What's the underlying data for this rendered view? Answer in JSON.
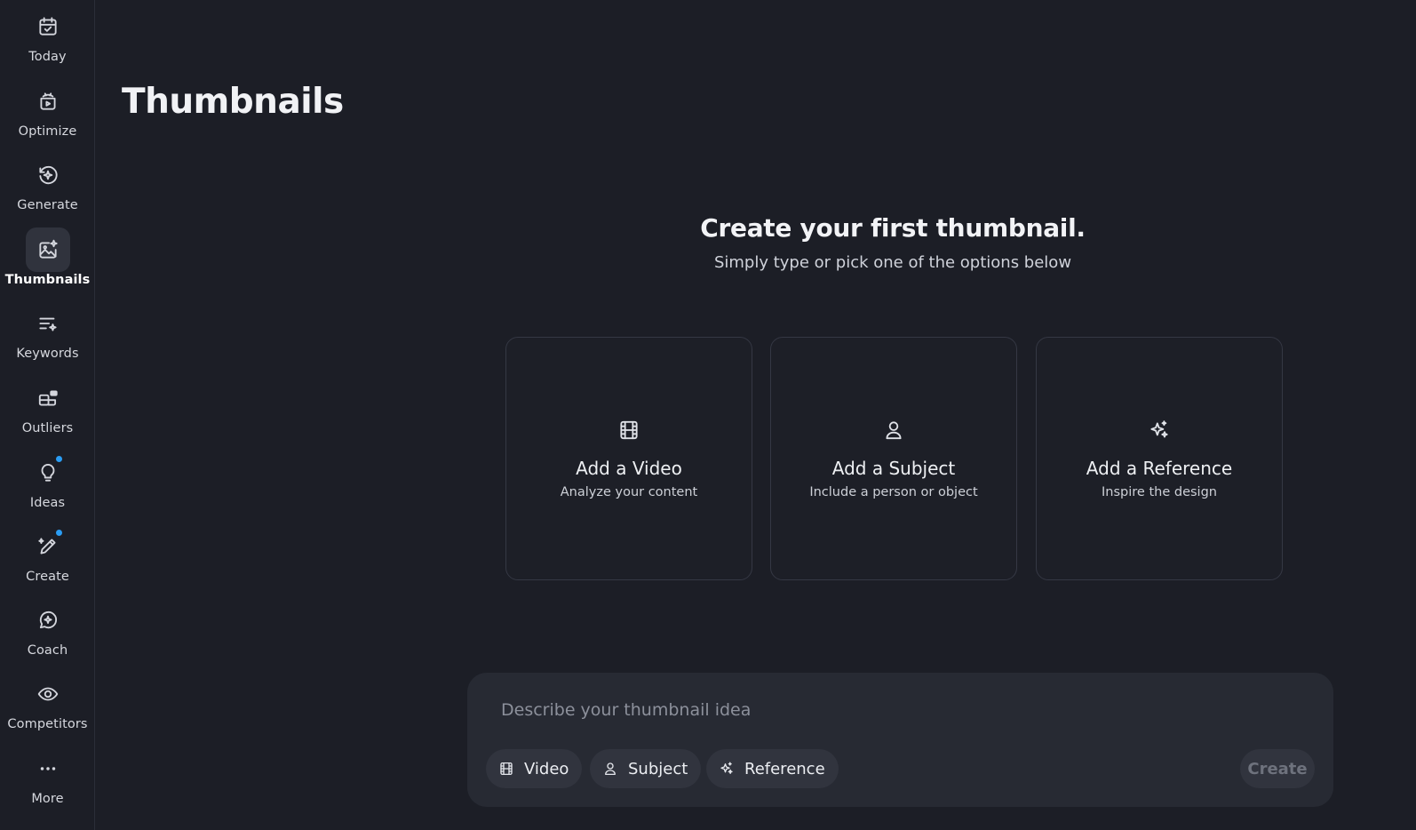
{
  "page": {
    "title": "Thumbnails"
  },
  "sidebar": {
    "items": [
      {
        "label": "Today",
        "icon": "calendar-check-icon",
        "active": false
      },
      {
        "label": "Optimize",
        "icon": "optimize-icon",
        "active": false
      },
      {
        "label": "Generate",
        "icon": "generate-icon",
        "active": false
      },
      {
        "label": "Thumbnails",
        "icon": "image-sparkle-icon",
        "active": true
      },
      {
        "label": "Keywords",
        "icon": "keywords-icon",
        "active": false
      },
      {
        "label": "Outliers",
        "icon": "outliers-icon",
        "active": false
      },
      {
        "label": "Ideas",
        "icon": "lightbulb-icon",
        "active": false,
        "badge": true
      },
      {
        "label": "Create",
        "icon": "pen-sparkle-icon",
        "active": false,
        "badge": true
      },
      {
        "label": "Coach",
        "icon": "chat-sparkle-icon",
        "active": false
      },
      {
        "label": "Competitors",
        "icon": "eye-icon",
        "active": false
      },
      {
        "label": "More",
        "icon": "more-dots-icon",
        "active": false
      }
    ],
    "badge_color": "#2a9df4"
  },
  "hero": {
    "title": "Create your first thumbnail.",
    "subtitle": "Simply type or pick one of the options below"
  },
  "cards": [
    {
      "title": "Add a Video",
      "desc": "Analyze your content",
      "icon": "film-icon"
    },
    {
      "title": "Add a Subject",
      "desc": "Include a person or object",
      "icon": "person-icon"
    },
    {
      "title": "Add a Reference",
      "desc": "Inspire the design",
      "icon": "sparkles-icon"
    }
  ],
  "composer": {
    "placeholder": "Describe your thumbnail idea",
    "value": "",
    "chips": [
      {
        "label": "Video",
        "icon": "film-icon"
      },
      {
        "label": "Subject",
        "icon": "person-icon"
      },
      {
        "label": "Reference",
        "icon": "sparkles-icon"
      }
    ],
    "create_label": "Create"
  }
}
